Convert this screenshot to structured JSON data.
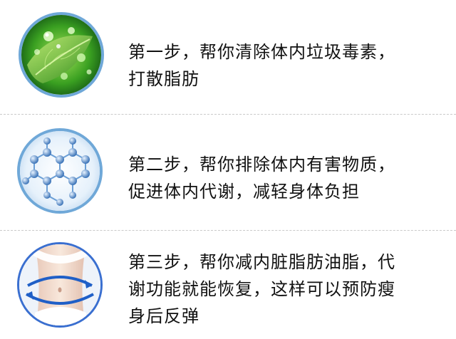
{
  "steps": [
    {
      "lines": [
        "第一步，帮你清除体内垃圾毒素，",
        "打散脂肪"
      ],
      "image": "green-leaf-with-water-drops"
    },
    {
      "lines": [
        "第二步，帮你排除体内有害物质，",
        "促进体内代谢，减轻身体负担"
      ],
      "image": "blue-molecular-structure"
    },
    {
      "lines": [
        "第三步，帮你减内脏脂肪油脂，代",
        "谢功能就能恢复，这样可以预防瘦",
        "身后反弹"
      ],
      "image": "waist-with-blue-arrows"
    }
  ],
  "colors": {
    "circle_border": "#6fa8d8",
    "divider": "#c9c9c9",
    "text": "#111111"
  }
}
